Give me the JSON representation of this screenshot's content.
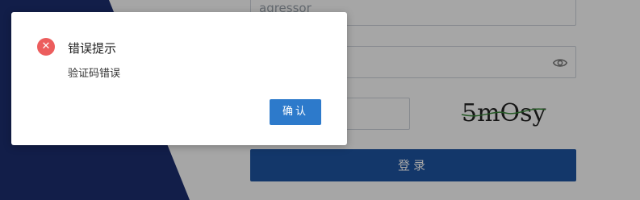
{
  "login_form": {
    "username_value": "agressor",
    "captcha_text": "5mOsy",
    "login_label": "登录"
  },
  "dialog": {
    "title": "错误提示",
    "message": "验证码错误",
    "ok_label": "确认"
  },
  "icons": {
    "error": "close-circle-icon",
    "password_toggle": "eye-icon"
  },
  "colors": {
    "primary": "#1e55a3",
    "dialog_button": "#2d7acb",
    "error": "#ec5d5d"
  }
}
